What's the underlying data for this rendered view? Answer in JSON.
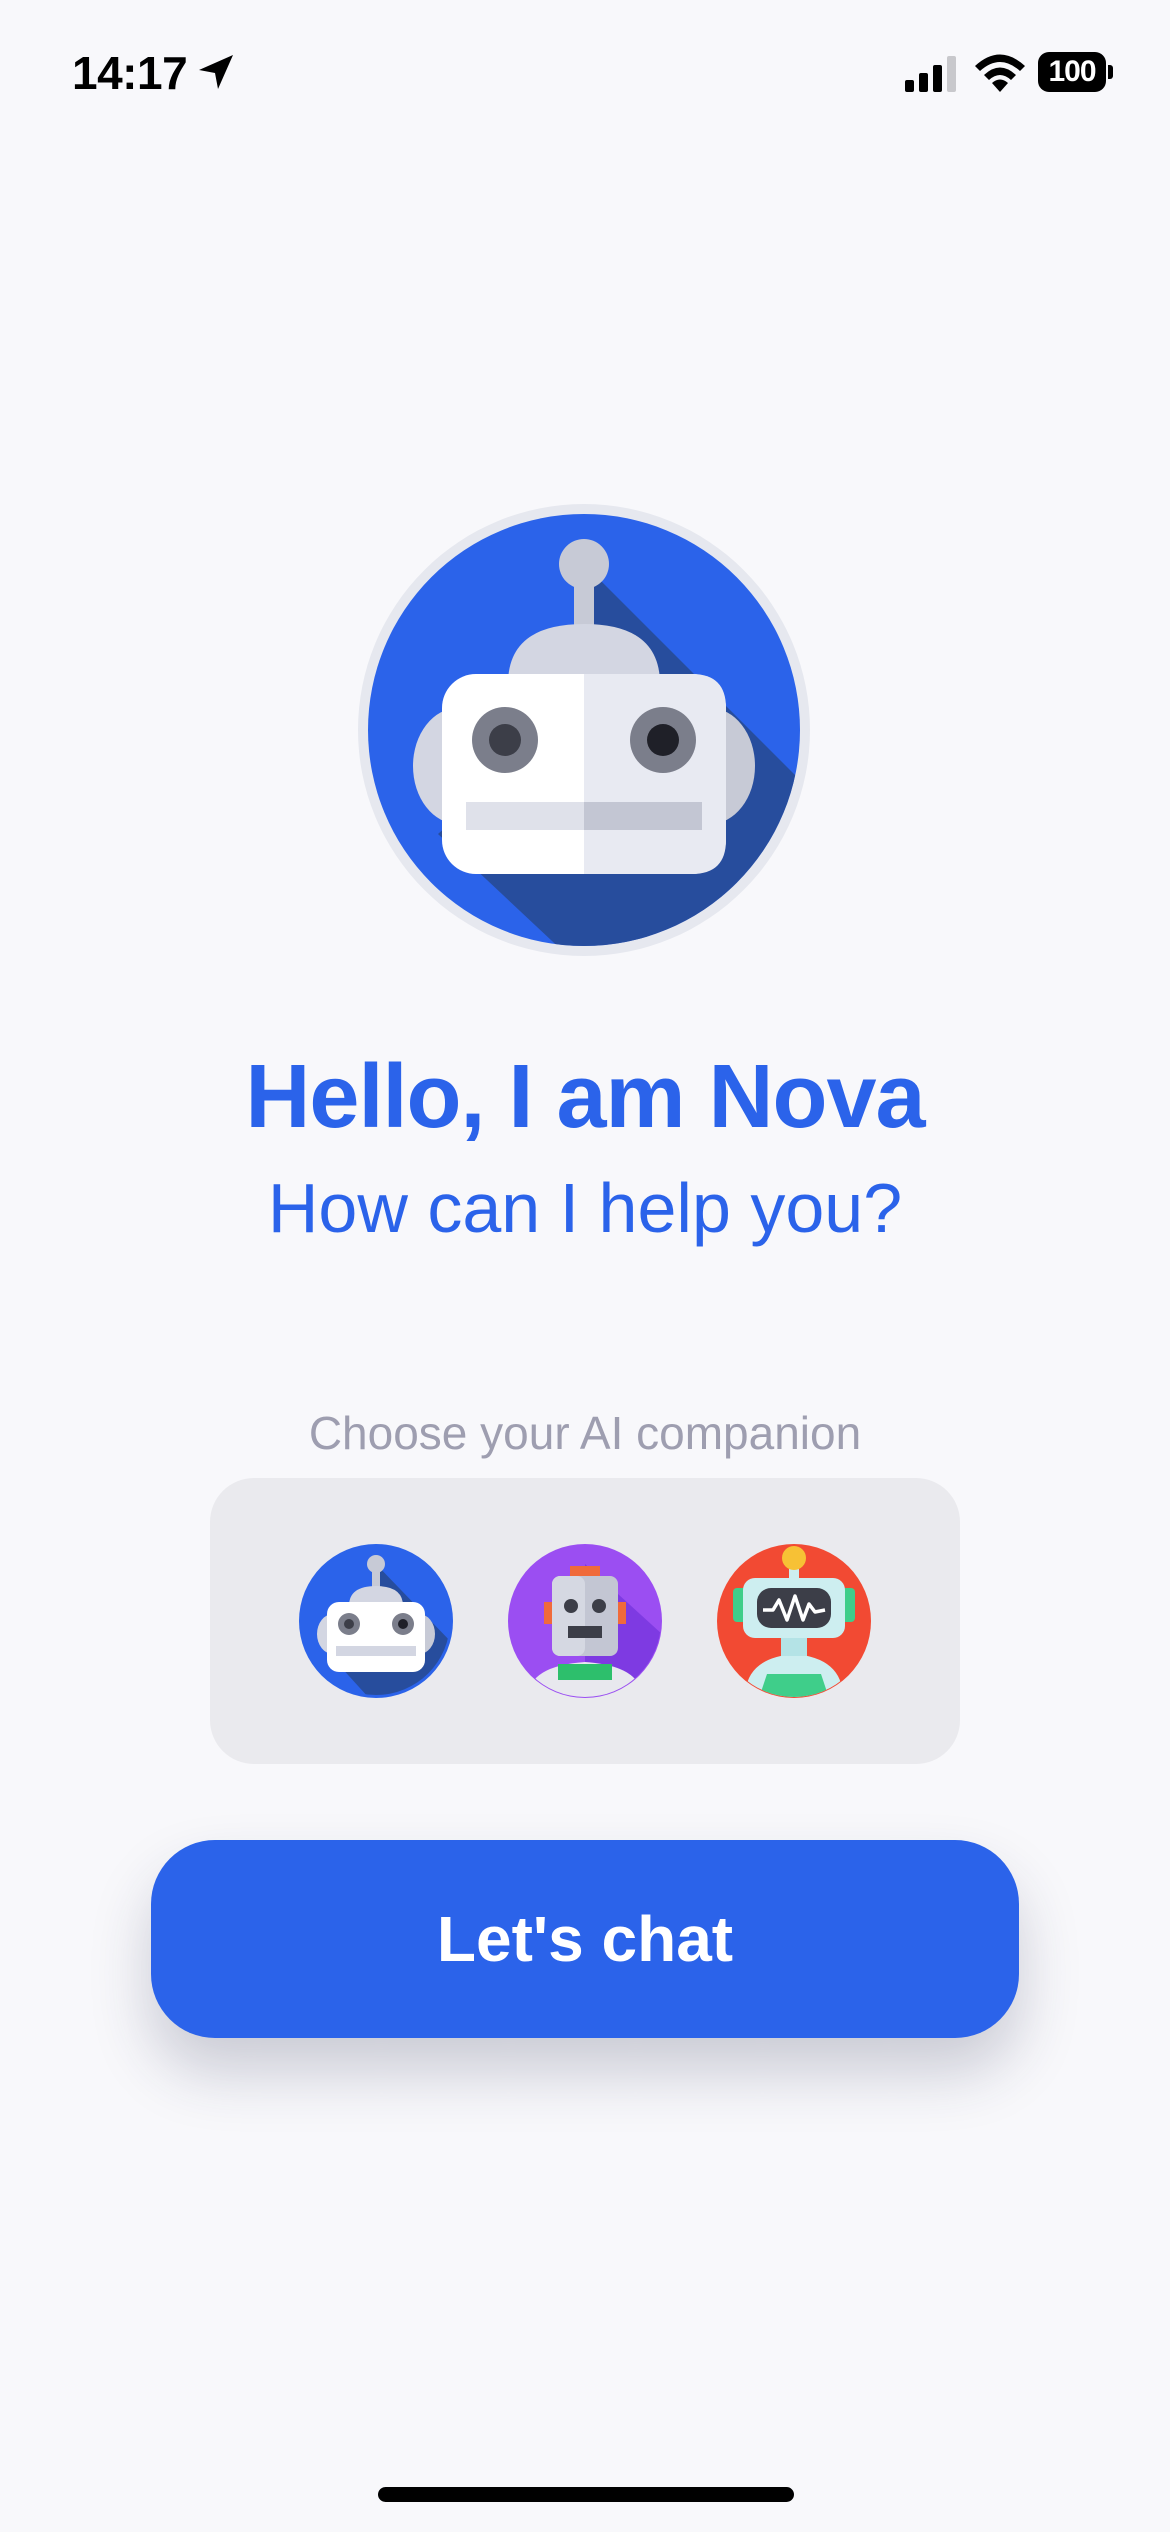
{
  "status_bar": {
    "time": "14:17",
    "battery": "100",
    "location_icon": "location-arrow-icon",
    "signal_icon": "cellular-signal-icon",
    "wifi_icon": "wifi-icon"
  },
  "hero": {
    "avatar_icon": "robot-icon",
    "title": "Hello, I am Nova",
    "subtitle": "How can I help you?"
  },
  "companions": {
    "label": "Choose your AI companion",
    "items": [
      {
        "icon": "blue-robot-icon",
        "color": "#2b63ea"
      },
      {
        "icon": "purple-robot-icon",
        "color": "#9b4ef2"
      },
      {
        "icon": "red-robot-icon",
        "color": "#f24a33"
      }
    ]
  },
  "cta": {
    "label": "Let's chat"
  },
  "colors": {
    "accent": "#2b63ea",
    "background": "#f8f8fb",
    "picker_bg": "#eaeaee",
    "muted_text": "#9e9eb0"
  }
}
